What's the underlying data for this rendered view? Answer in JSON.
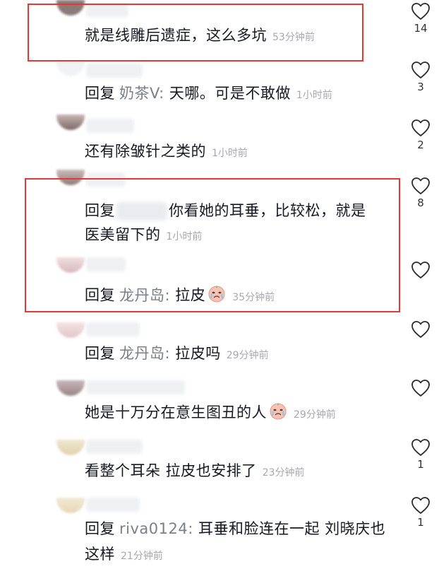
{
  "comments": [
    {
      "text": "就是线雕后遗症，这么多坑",
      "time": "53分钟前",
      "likes": "14",
      "avatar_color": "#8a7a78"
    },
    {
      "reply_kw": "回复",
      "reply_to": "奶茶V:",
      "text": "天哪。可是不敢做",
      "time": "1小时前",
      "likes": "3",
      "avatar_color": "#f1f2f3"
    },
    {
      "text": "还有除皱针之类的",
      "time": "1小时前",
      "likes": "2",
      "avatar_color": "#b49c98"
    },
    {
      "reply_kw": "回复",
      "text": "你看她的耳垂，比较松，就是",
      "text2": "医美留下的",
      "time": "1小时前",
      "likes": "8",
      "avatar_color": "#9b8a86"
    },
    {
      "reply_kw": "回复",
      "reply_to": "龙丹岛:",
      "text": "拉皮",
      "time": "35分钟前",
      "likes": "",
      "avatar_color": "#e2c9cb"
    },
    {
      "reply_kw": "回复",
      "reply_to": "龙丹岛:",
      "text": "拉皮吗",
      "time": "29分钟前",
      "likes": "",
      "avatar_color": "#ecd6d8"
    },
    {
      "text": "她是十万分在意生图丑的人",
      "time": "29分钟前",
      "likes": "",
      "avatar_color": "#a89496"
    },
    {
      "text": "看整个耳朵 拉皮也安排了",
      "time": "23分钟前",
      "likes": "1",
      "avatar_color": "#e8dcc0"
    },
    {
      "reply_kw": "回复",
      "reply_to": "riva0124:",
      "text": "耳垂和脸连在一起 刘晓庆也",
      "text2": "这样",
      "time": "21分钟前",
      "likes": "1",
      "avatar_color": "#efe2c8"
    }
  ],
  "colors": {
    "highlight": "#e53935",
    "secondary_text": "#a7a8ad",
    "reply_name": "#7b7f88"
  }
}
